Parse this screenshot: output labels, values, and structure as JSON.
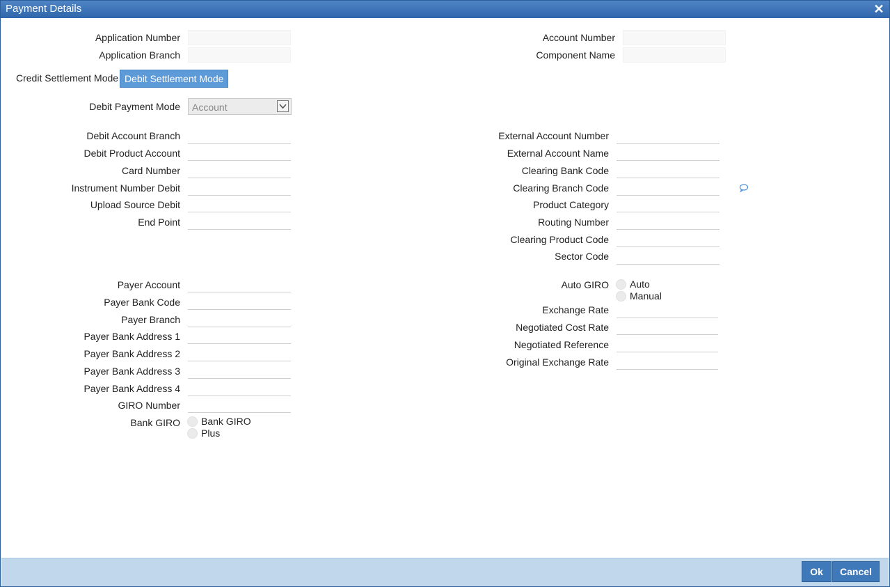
{
  "window": {
    "title": "Payment Details",
    "close_glyph": "✕"
  },
  "header": {
    "application_number_label": "Application Number",
    "application_branch_label": "Application Branch",
    "account_number_label": "Account Number",
    "component_name_label": "Component Name",
    "application_number_value": "",
    "application_branch_value": "",
    "account_number_value": "",
    "component_name_value": ""
  },
  "tabs": [
    {
      "label": "Credit Settlement Mode",
      "active": false
    },
    {
      "label": "Debit Settlement Mode",
      "active": true
    }
  ],
  "debit": {
    "payment_mode_label": "Debit Payment Mode",
    "payment_mode_value": "Account",
    "left_fields": [
      {
        "label": "Debit Account Branch",
        "value": ""
      },
      {
        "label": "Debit Product Account",
        "value": ""
      },
      {
        "label": "Card Number",
        "value": ""
      },
      {
        "label": "Instrument Number Debit",
        "value": ""
      },
      {
        "label": "Upload Source Debit",
        "value": ""
      },
      {
        "label": "End Point",
        "value": ""
      }
    ],
    "right_fields": [
      {
        "label": "External Account Number",
        "value": ""
      },
      {
        "label": "External Account Name",
        "value": ""
      },
      {
        "label": "Clearing Bank Code",
        "value": ""
      },
      {
        "label": "Clearing Branch Code",
        "value": ""
      },
      {
        "label": "Product Category",
        "value": ""
      },
      {
        "label": "Routing Number",
        "value": ""
      },
      {
        "label": "Clearing Product Code",
        "value": ""
      },
      {
        "label": "Sector Code",
        "value": ""
      }
    ],
    "payer_fields": [
      {
        "label": "Payer Account",
        "value": ""
      },
      {
        "label": "Payer Bank Code",
        "value": ""
      },
      {
        "label": "Payer Branch",
        "value": ""
      },
      {
        "label": "Payer Bank Address 1",
        "value": ""
      },
      {
        "label": "Payer Bank Address 2",
        "value": ""
      },
      {
        "label": "Payer Bank Address 3",
        "value": ""
      },
      {
        "label": "Payer Bank Address 4",
        "value": ""
      },
      {
        "label": "GIRO Number",
        "value": ""
      }
    ],
    "bank_giro": {
      "label": "Bank GIRO",
      "options": [
        "Bank GIRO",
        "Plus"
      ]
    },
    "auto_giro": {
      "label": "Auto GIRO",
      "options": [
        "Auto",
        "Manual"
      ]
    },
    "rate_fields": [
      {
        "label": "Exchange Rate",
        "value": ""
      },
      {
        "label": "Negotiated Cost Rate",
        "value": ""
      },
      {
        "label": "Negotiated Reference",
        "value": ""
      },
      {
        "label": "Original Exchange Rate",
        "value": ""
      }
    ]
  },
  "footer": {
    "ok_label": "Ok",
    "cancel_label": "Cancel"
  },
  "colors": {
    "titlebar": "#3a70b3",
    "active_tab": "#5d9ad8",
    "footer": "#c1d8ec",
    "button": "#3f79b9",
    "comment_icon": "#4a90d9"
  },
  "icons": {
    "close": "close-icon",
    "dropdown": "chevron-down-icon",
    "comment": "speech-bubble-icon"
  }
}
